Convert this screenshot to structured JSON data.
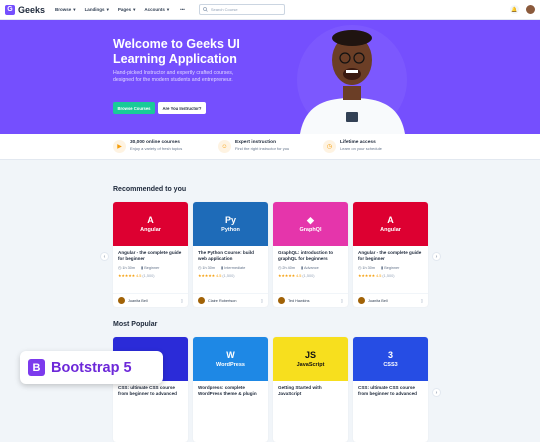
{
  "nav": {
    "logo_letter": "G",
    "logo_text": "Geeks",
    "menu": [
      "Browse",
      "Landings",
      "Pages",
      "Accounts"
    ],
    "more": "•••",
    "search_placeholder": "Search Course"
  },
  "hero": {
    "title": "Welcome to Geeks UI Learning Application",
    "description": "Hand-picked Instructor and expertly crafted courses, designed for the modern students and entrepreneur.",
    "primary_button": "Browse Courses",
    "secondary_button": "Are You Instructor?"
  },
  "features": [
    {
      "icon": "video-icon",
      "title": "30,000 online courses",
      "desc": "Enjoy a variety of fresh topics"
    },
    {
      "icon": "user-icon",
      "title": "Expert instruction",
      "desc": "Find the right instructor for you"
    },
    {
      "icon": "clock-icon",
      "title": "Lifetime access",
      "desc": "Learn on your schedule"
    }
  ],
  "sections": {
    "recommended": "Recommended to you",
    "popular": "Most Popular"
  },
  "recommended_cards": [
    {
      "icon": "A",
      "name": "Angular",
      "color": "#dd0031",
      "title": "Angular - the complete guide for beginner",
      "duration": "1h 30m",
      "level": "Beginner",
      "rating": "4.5",
      "count": "(1,500)",
      "author": "Juanita Bell"
    },
    {
      "icon": "Py",
      "name": "Python",
      "color": "#1e6bb8",
      "title": "The Python Course: build web application",
      "duration": "1h 30m",
      "level": "Intermediate",
      "rating": "4.5",
      "count": "(1,500)",
      "author": "Claire Robertson"
    },
    {
      "icon": "◆",
      "name": "GraphQl",
      "color": "#e535ab",
      "title": "GraphQL: introduction to graphQL for beginners",
      "duration": "2h 40m",
      "level": "Advance",
      "rating": "4.5",
      "count": "(1,500)",
      "author": "Ted Hawkins"
    },
    {
      "icon": "A",
      "name": "Angular",
      "color": "#dd0031",
      "title": "Angular - the complete guide for beginner",
      "duration": "1h 30m",
      "level": "Beginner",
      "rating": "4.5",
      "count": "(1,500)",
      "author": "Juanita Bell"
    }
  ],
  "popular_cards": [
    {
      "icon": "5",
      "name": "",
      "color": "#2b2bd8",
      "title": "CSS: ultimate CSS course from beginner to advanced"
    },
    {
      "icon": "W",
      "name": "WordPress",
      "color": "#1e88e5",
      "title": "Wordpress: complete WordPress theme & plugin"
    },
    {
      "icon": "JS",
      "name": "JavaScript",
      "color": "#f7df1e",
      "title": "Getting Started with JavaScript"
    },
    {
      "icon": "3",
      "name": "CSS3",
      "color": "#264de4",
      "title": "CSS: ultimate CSS course from beginner to advanced"
    }
  ],
  "badge": {
    "letter": "B",
    "text": "Bootstrap 5"
  },
  "colors": {
    "brand": "#754ffe",
    "success": "#19cb98"
  }
}
